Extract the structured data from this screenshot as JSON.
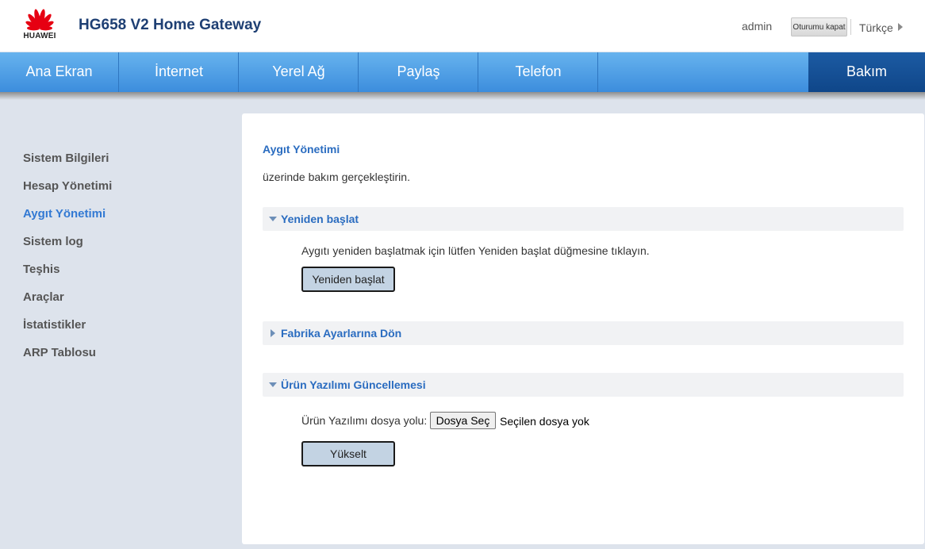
{
  "header": {
    "brand": "HUAWEI",
    "title": "HG658 V2 Home Gateway",
    "user": "admin",
    "logout_label": "Oturumu kapat",
    "language": "Türkçe"
  },
  "nav": {
    "items": [
      {
        "label": "Ana Ekran"
      },
      {
        "label": "İnternet"
      },
      {
        "label": "Yerel Ağ"
      },
      {
        "label": "Paylaş"
      },
      {
        "label": "Telefon"
      },
      {
        "label": "Bakım"
      }
    ],
    "active": "Bakım"
  },
  "sidebar": {
    "items": [
      {
        "label": "Sistem Bilgileri"
      },
      {
        "label": "Hesap Yönetimi"
      },
      {
        "label": "Aygıt Yönetimi"
      },
      {
        "label": "Sistem log"
      },
      {
        "label": "Teşhis"
      },
      {
        "label": "Araçlar"
      },
      {
        "label": "İstatistikler"
      },
      {
        "label": "ARP Tablosu"
      }
    ],
    "active": "Aygıt Yönetimi"
  },
  "main": {
    "title": "Aygıt Yönetimi",
    "description": "üzerinde bakım gerçekleştirin.",
    "sections": {
      "reboot": {
        "title": "Yeniden başlat",
        "expanded": true,
        "instruction": "Aygıtı yeniden başlatmak için lütfen Yeniden başlat düğmesine tıklayın.",
        "button": "Yeniden başlat"
      },
      "factory": {
        "title": "Fabrika Ayarlarına Dön",
        "expanded": false
      },
      "firmware": {
        "title": "Ürün Yazılımı Güncellemesi",
        "expanded": true,
        "path_label": "Ürün Yazılımı dosya yolu:",
        "choose_button": "Dosya Seç",
        "no_file": "Seçilen dosya yok",
        "button": "Yükselt"
      }
    }
  },
  "colors": {
    "nav_gradient_top": "#67b3ee",
    "nav_gradient_bottom": "#3c8ddd",
    "nav_active": "#0f4689",
    "accent": "#2a6cc0",
    "sidebar_bg": "#dde3ec",
    "button_bg": "#c3d3e3"
  },
  "icons": {
    "logo": "huawei-petal-logo",
    "section_expanded": "triangle-down-icon",
    "section_collapsed": "triangle-right-icon",
    "language_arrow": "triangle-right-icon"
  }
}
